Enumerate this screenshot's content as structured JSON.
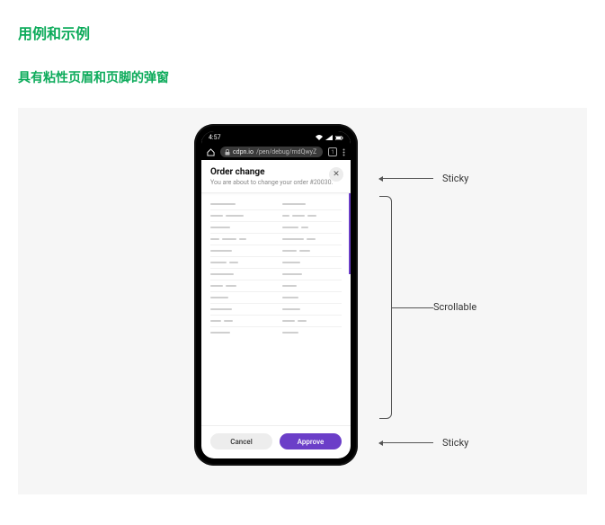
{
  "headings": {
    "h1": "用例和示例",
    "h2": "具有粘性页眉和页脚的弹窗"
  },
  "phone": {
    "status_time": "4:57",
    "url_prefix": "cdpn.io",
    "url_rest": "/pen/debug/mdQwyZ",
    "tab_count": "1"
  },
  "modal": {
    "title": "Order change",
    "subtitle": "You are about to change your order #20030.",
    "close_glyph": "✕",
    "cancel": "Cancel",
    "approve": "Approve"
  },
  "annotations": {
    "sticky_top": "Sticky",
    "scrollable": "Scrollable",
    "sticky_bottom": "Sticky"
  }
}
